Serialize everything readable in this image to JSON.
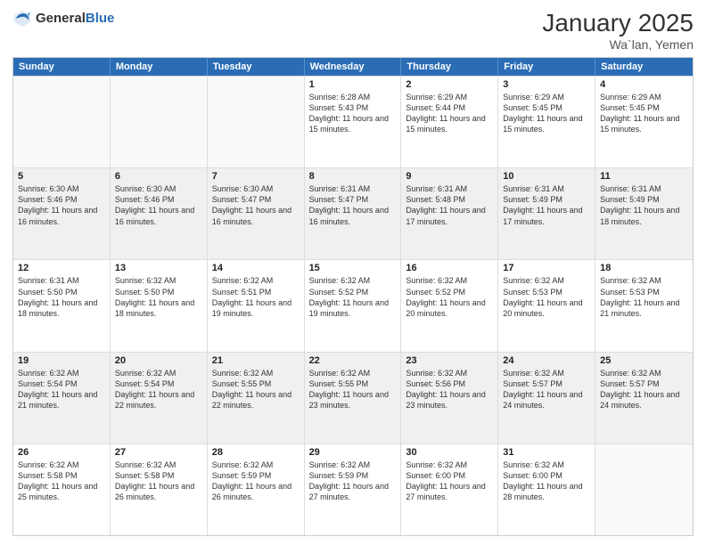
{
  "logo": {
    "general": "General",
    "blue": "Blue"
  },
  "title": "January 2025",
  "location": "Wa`lan, Yemen",
  "days": [
    "Sunday",
    "Monday",
    "Tuesday",
    "Wednesday",
    "Thursday",
    "Friday",
    "Saturday"
  ],
  "weeks": [
    [
      {
        "num": "",
        "sunrise": "",
        "sunset": "",
        "daylight": "",
        "empty": true
      },
      {
        "num": "",
        "sunrise": "",
        "sunset": "",
        "daylight": "",
        "empty": true
      },
      {
        "num": "",
        "sunrise": "",
        "sunset": "",
        "daylight": "",
        "empty": true
      },
      {
        "num": "1",
        "sunrise": "Sunrise: 6:28 AM",
        "sunset": "Sunset: 5:43 PM",
        "daylight": "Daylight: 11 hours and 15 minutes."
      },
      {
        "num": "2",
        "sunrise": "Sunrise: 6:29 AM",
        "sunset": "Sunset: 5:44 PM",
        "daylight": "Daylight: 11 hours and 15 minutes."
      },
      {
        "num": "3",
        "sunrise": "Sunrise: 6:29 AM",
        "sunset": "Sunset: 5:45 PM",
        "daylight": "Daylight: 11 hours and 15 minutes."
      },
      {
        "num": "4",
        "sunrise": "Sunrise: 6:29 AM",
        "sunset": "Sunset: 5:45 PM",
        "daylight": "Daylight: 11 hours and 15 minutes."
      }
    ],
    [
      {
        "num": "5",
        "sunrise": "Sunrise: 6:30 AM",
        "sunset": "Sunset: 5:46 PM",
        "daylight": "Daylight: 11 hours and 16 minutes."
      },
      {
        "num": "6",
        "sunrise": "Sunrise: 6:30 AM",
        "sunset": "Sunset: 5:46 PM",
        "daylight": "Daylight: 11 hours and 16 minutes."
      },
      {
        "num": "7",
        "sunrise": "Sunrise: 6:30 AM",
        "sunset": "Sunset: 5:47 PM",
        "daylight": "Daylight: 11 hours and 16 minutes."
      },
      {
        "num": "8",
        "sunrise": "Sunrise: 6:31 AM",
        "sunset": "Sunset: 5:47 PM",
        "daylight": "Daylight: 11 hours and 16 minutes."
      },
      {
        "num": "9",
        "sunrise": "Sunrise: 6:31 AM",
        "sunset": "Sunset: 5:48 PM",
        "daylight": "Daylight: 11 hours and 17 minutes."
      },
      {
        "num": "10",
        "sunrise": "Sunrise: 6:31 AM",
        "sunset": "Sunset: 5:49 PM",
        "daylight": "Daylight: 11 hours and 17 minutes."
      },
      {
        "num": "11",
        "sunrise": "Sunrise: 6:31 AM",
        "sunset": "Sunset: 5:49 PM",
        "daylight": "Daylight: 11 hours and 18 minutes."
      }
    ],
    [
      {
        "num": "12",
        "sunrise": "Sunrise: 6:31 AM",
        "sunset": "Sunset: 5:50 PM",
        "daylight": "Daylight: 11 hours and 18 minutes."
      },
      {
        "num": "13",
        "sunrise": "Sunrise: 6:32 AM",
        "sunset": "Sunset: 5:50 PM",
        "daylight": "Daylight: 11 hours and 18 minutes."
      },
      {
        "num": "14",
        "sunrise": "Sunrise: 6:32 AM",
        "sunset": "Sunset: 5:51 PM",
        "daylight": "Daylight: 11 hours and 19 minutes."
      },
      {
        "num": "15",
        "sunrise": "Sunrise: 6:32 AM",
        "sunset": "Sunset: 5:52 PM",
        "daylight": "Daylight: 11 hours and 19 minutes."
      },
      {
        "num": "16",
        "sunrise": "Sunrise: 6:32 AM",
        "sunset": "Sunset: 5:52 PM",
        "daylight": "Daylight: 11 hours and 20 minutes."
      },
      {
        "num": "17",
        "sunrise": "Sunrise: 6:32 AM",
        "sunset": "Sunset: 5:53 PM",
        "daylight": "Daylight: 11 hours and 20 minutes."
      },
      {
        "num": "18",
        "sunrise": "Sunrise: 6:32 AM",
        "sunset": "Sunset: 5:53 PM",
        "daylight": "Daylight: 11 hours and 21 minutes."
      }
    ],
    [
      {
        "num": "19",
        "sunrise": "Sunrise: 6:32 AM",
        "sunset": "Sunset: 5:54 PM",
        "daylight": "Daylight: 11 hours and 21 minutes."
      },
      {
        "num": "20",
        "sunrise": "Sunrise: 6:32 AM",
        "sunset": "Sunset: 5:54 PM",
        "daylight": "Daylight: 11 hours and 22 minutes."
      },
      {
        "num": "21",
        "sunrise": "Sunrise: 6:32 AM",
        "sunset": "Sunset: 5:55 PM",
        "daylight": "Daylight: 11 hours and 22 minutes."
      },
      {
        "num": "22",
        "sunrise": "Sunrise: 6:32 AM",
        "sunset": "Sunset: 5:55 PM",
        "daylight": "Daylight: 11 hours and 23 minutes."
      },
      {
        "num": "23",
        "sunrise": "Sunrise: 6:32 AM",
        "sunset": "Sunset: 5:56 PM",
        "daylight": "Daylight: 11 hours and 23 minutes."
      },
      {
        "num": "24",
        "sunrise": "Sunrise: 6:32 AM",
        "sunset": "Sunset: 5:57 PM",
        "daylight": "Daylight: 11 hours and 24 minutes."
      },
      {
        "num": "25",
        "sunrise": "Sunrise: 6:32 AM",
        "sunset": "Sunset: 5:57 PM",
        "daylight": "Daylight: 11 hours and 24 minutes."
      }
    ],
    [
      {
        "num": "26",
        "sunrise": "Sunrise: 6:32 AM",
        "sunset": "Sunset: 5:58 PM",
        "daylight": "Daylight: 11 hours and 25 minutes."
      },
      {
        "num": "27",
        "sunrise": "Sunrise: 6:32 AM",
        "sunset": "Sunset: 5:58 PM",
        "daylight": "Daylight: 11 hours and 26 minutes."
      },
      {
        "num": "28",
        "sunrise": "Sunrise: 6:32 AM",
        "sunset": "Sunset: 5:59 PM",
        "daylight": "Daylight: 11 hours and 26 minutes."
      },
      {
        "num": "29",
        "sunrise": "Sunrise: 6:32 AM",
        "sunset": "Sunset: 5:59 PM",
        "daylight": "Daylight: 11 hours and 27 minutes."
      },
      {
        "num": "30",
        "sunrise": "Sunrise: 6:32 AM",
        "sunset": "Sunset: 6:00 PM",
        "daylight": "Daylight: 11 hours and 27 minutes."
      },
      {
        "num": "31",
        "sunrise": "Sunrise: 6:32 AM",
        "sunset": "Sunset: 6:00 PM",
        "daylight": "Daylight: 11 hours and 28 minutes."
      },
      {
        "num": "",
        "sunrise": "",
        "sunset": "",
        "daylight": "",
        "empty": true
      }
    ]
  ]
}
